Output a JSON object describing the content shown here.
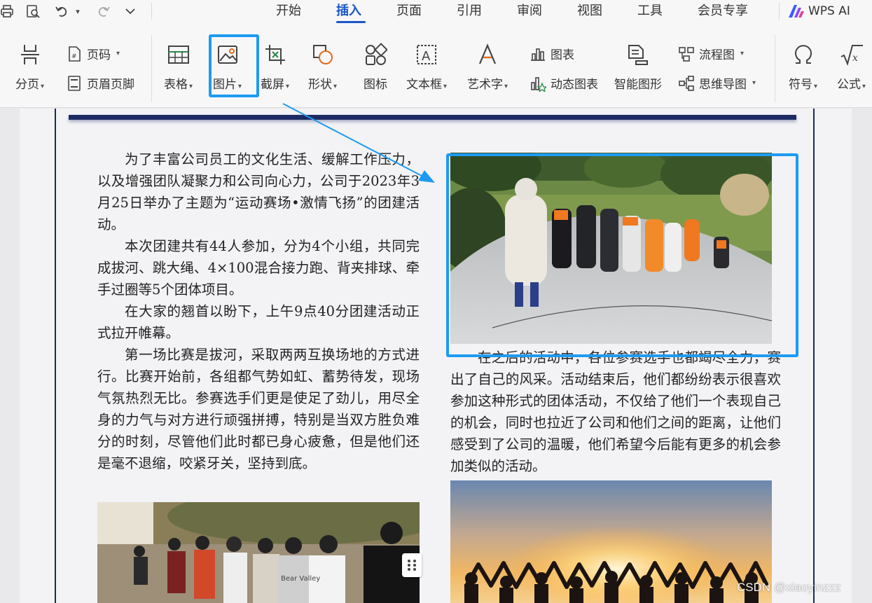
{
  "menu_tabs": [
    {
      "label": "开始"
    },
    {
      "label": "插入"
    },
    {
      "label": "页面"
    },
    {
      "label": "引用"
    },
    {
      "label": "审阅"
    },
    {
      "label": "视图"
    },
    {
      "label": "工具"
    },
    {
      "label": "会员专享"
    }
  ],
  "active_tab": "插入",
  "wps_ai": "WPS AI",
  "ribbon": {
    "page_break": "分页",
    "page_number": "页码",
    "header_footer": "页眉页脚",
    "table": "表格",
    "picture": "图片",
    "screenshot": "截屏",
    "shape": "形状",
    "icon": "图标",
    "textbox": "文本框",
    "wordart": "艺术字",
    "chart": "图表",
    "dynamic_chart": "动态图表",
    "smart_graphic": "智能图形",
    "flowchart": "流程图",
    "mindmap": "思维导图",
    "symbol": "符号",
    "formula": "公式"
  },
  "document": {
    "left_paragraphs": [
      "为了丰富公司员工的文化生活、缓解工作压力，以及增强团队凝聚力和公司向心力，公司于2023年3月25日举办了主题为“运动赛场•激情飞扬”的团建活动。",
      "本次团建共有44人参加，分为4个小组，共同完成拔河、跳大绳、4×100混合接力跑、背夹排球、牵手过圈等5个团体项目。",
      "在大家的翘首以盼下，上午9点40分团建活动正式拉开帷幕。",
      "第一场比赛是拔河，采取两两互换场地的方式进行。比赛开始前，各组都气势如虹、蓄势待发，现场气氛热烈无比。参赛选手们更是使足了劲儿，用尽全身的力气与对方进行顽强拼搏，特别是当双方胜负难分的时刻，尽管他们此时都已身心疲惫，但是他们还是毫不退缩，咬紧牙关，坚持到底。"
    ],
    "right_paragraphs": [
      "在之后的活动中，各位参赛选手也都竭尽全力，赛出了自己的风采。活动结束后，他们都纷纷表示很喜欢参加这种形式的团体活动，不仅给了他们一个表现自己的机会，同时也拉近了公司和他们之间的距离，让他们感受到了公司的温暖，他们希望今后能有更多的机会参加类似的活动。"
    ],
    "shirt_text": "Bear Valley"
  },
  "watermark": "CSDN @xiaoyinzzz",
  "colors": {
    "accent": "#1a56c9",
    "highlight": "#1e9bf0",
    "page_border": "#1b2a55"
  }
}
